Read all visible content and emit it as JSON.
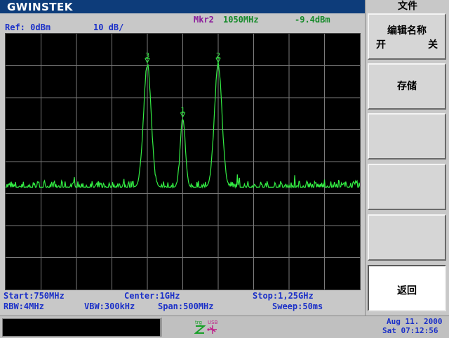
{
  "brand": "GWINSTEK",
  "header": {
    "ref_level": "Ref: 0dBm",
    "scale": "10 dB/",
    "marker_label": "Mkr2",
    "marker_freq": "1050MHz",
    "marker_level": "-9.4dBm"
  },
  "trace": {
    "color": "#33ee44",
    "markers": [
      {
        "id": "1",
        "freq_mhz": 1000,
        "level_dbm": -26.5
      },
      {
        "id": "2",
        "freq_mhz": 1050,
        "level_dbm": -9.4
      },
      {
        "id": "3",
        "freq_mhz": 950,
        "level_dbm": -9.5
      }
    ],
    "noise_floor_dbm": -48
  },
  "footer": {
    "start": "Start:750MHz",
    "center": "Center:1GHz",
    "stop": "Stop:1,25GHz",
    "rbw": "RBW:4MHz",
    "vbw": "VBW:300kHz",
    "span": "Span:500MHz",
    "sweep": "Sweep:50ms"
  },
  "menu": {
    "title": "文件",
    "keys": [
      {
        "label": "编辑名称",
        "on": "开",
        "off": "关"
      },
      {
        "label": "存储"
      },
      {
        "label": ""
      },
      {
        "label": ""
      },
      {
        "label": ""
      },
      {
        "label": "返回"
      }
    ]
  },
  "status": {
    "trig_icon": "trigger-icon",
    "usb_icon": "usb-icon",
    "usb_text": "USB",
    "trig_text": "trg",
    "date": "Aug 11. 2000",
    "time": "Sat  07:12:56"
  },
  "colors": {
    "title_bar": "#0d3c7a",
    "info_text": "#1b30c8",
    "marker_label": "#8a1a9a",
    "marker_value": "#168a2a"
  }
}
